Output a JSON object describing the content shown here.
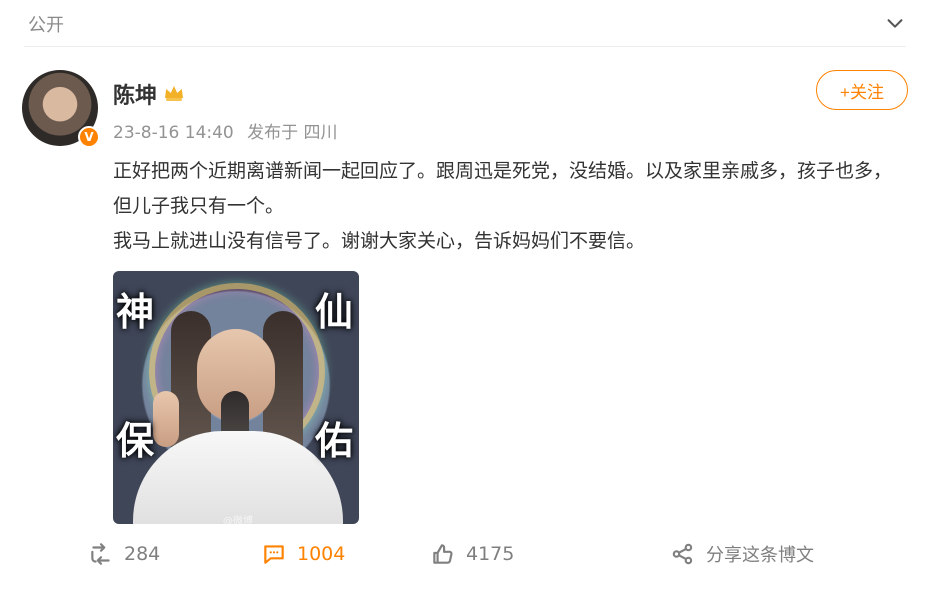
{
  "header": {
    "scope": "公开",
    "chevron_icon": "chevron-down-icon"
  },
  "post": {
    "author": "陈坤",
    "verified_badge": "V",
    "meta": {
      "time": "23-8-16 14:40",
      "location": "发布于 四川"
    },
    "follow_button": "+关注",
    "text": [
      "正好把两个近期离谱新闻一起回应了。跟周迅是死党，没结婚。以及家里亲戚多，孩子也多，但儿子我只有一个。",
      "我马上就进山没有信号了。谢谢大家关心，告诉妈妈们不要信。"
    ],
    "image": {
      "chars": [
        "神",
        "仙",
        "保",
        "佑"
      ],
      "watermark": "@微博"
    }
  },
  "actions": {
    "repost": "284",
    "comment": "1004",
    "like": "4175",
    "share": "分享这条博文"
  },
  "colors": {
    "accent": "#ff8200",
    "muted": "#8a8a8a"
  }
}
